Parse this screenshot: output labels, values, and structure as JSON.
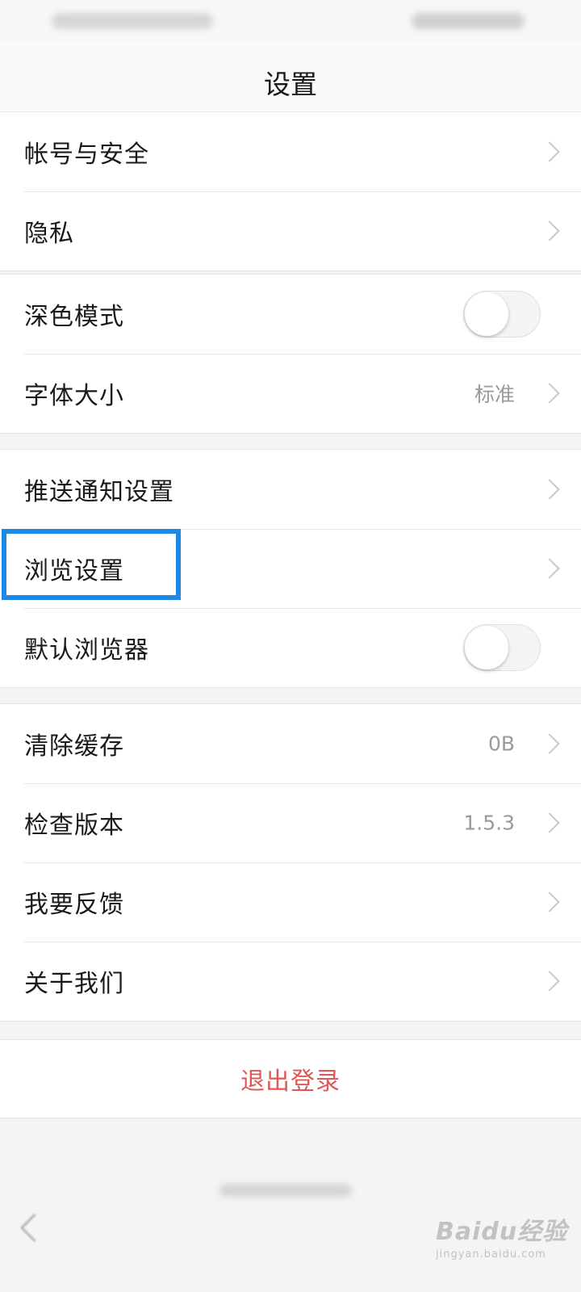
{
  "nav": {
    "title": "设置"
  },
  "groups": [
    {
      "items": [
        {
          "label": "帐号与安全",
          "value": "",
          "control": "chevron-right-icon"
        },
        {
          "label": "隐私",
          "value": "",
          "control": "chevron-right-icon"
        }
      ]
    },
    {
      "items": [
        {
          "label": "深色模式",
          "value": "",
          "control": "toggle",
          "toggle_on": false
        },
        {
          "label": "字体大小",
          "value": "标准",
          "control": "chevron-right-icon"
        }
      ]
    },
    {
      "items": [
        {
          "label": "推送通知设置",
          "value": "",
          "control": "chevron-right-icon"
        },
        {
          "label": "浏览设置",
          "value": "",
          "control": "chevron-right-icon",
          "highlighted": true
        },
        {
          "label": "默认浏览器",
          "value": "",
          "control": "toggle",
          "toggle_on": false
        }
      ]
    },
    {
      "items": [
        {
          "label": "清除缓存",
          "value": "0B",
          "control": "chevron-right-icon"
        },
        {
          "label": "检查版本",
          "value": "1.5.3",
          "control": "chevron-right-icon"
        },
        {
          "label": "我要反馈",
          "value": "",
          "control": "chevron-right-icon"
        },
        {
          "label": "关于我们",
          "value": "",
          "control": "chevron-right-icon"
        }
      ]
    }
  ],
  "logout": {
    "label": "退出登录"
  },
  "watermark": {
    "main": "Baidu经验",
    "sub": "jingyan.baidu.com"
  },
  "colors": {
    "highlight_border": "#1e88e5",
    "logout_text": "#e05757",
    "page_background": "#f4f4f4"
  }
}
